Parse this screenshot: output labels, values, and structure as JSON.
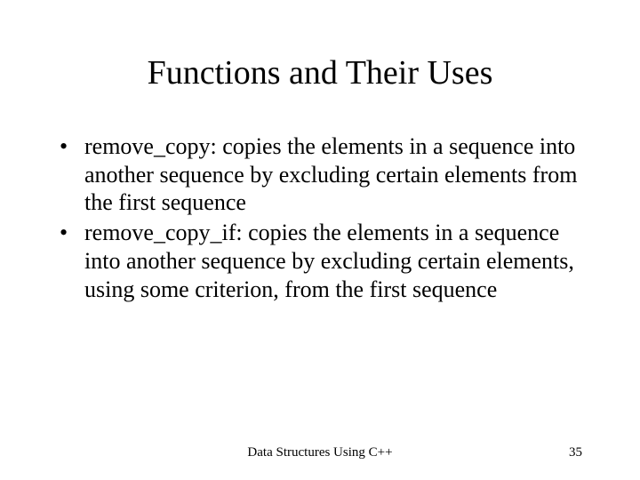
{
  "slide": {
    "title": "Functions and Their Uses",
    "bullets": [
      "remove_copy: copies the elements in a sequence into another sequence by excluding certain elements from the first sequence",
      "remove_copy_if: copies the elements in a sequence into another sequence by excluding certain elements, using some criterion, from the first sequence"
    ],
    "footer": "Data Structures Using C++",
    "page_number": "35"
  }
}
